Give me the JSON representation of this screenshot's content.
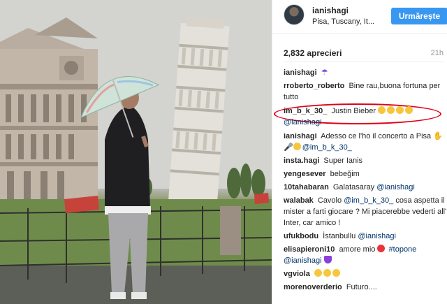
{
  "post": {
    "username": "ianishagi",
    "location": "Pisa, Tuscany, It...",
    "follow_label": "Urmărește",
    "likes": "2,832 aprecieri",
    "time": "21h"
  },
  "colors": {
    "follow_button": "#3897f0",
    "mention": "#003569",
    "highlight_ellipse": "#e0001b"
  },
  "comments": [
    {
      "user": "ianishagi",
      "text": "",
      "emoji": "umbrella-icon"
    },
    {
      "user": "rroberto_roberto",
      "text": "Bine rau,buona fortuna per tutto"
    },
    {
      "user": "im_b_k_30_",
      "text": "Justin Bieber",
      "emoji": "laughing-icon x4",
      "mention": "@ianishagi"
    },
    {
      "user": "ianishagi",
      "text": "Adesso ce l'ho il concerto a Pisa",
      "mention": "@im_b_k_30_"
    },
    {
      "user": "insta.hagi",
      "text": "Super Ianis"
    },
    {
      "user": "yengesever",
      "text": "bebeğim"
    },
    {
      "user": "10tahabaran",
      "text": "Galatasaray",
      "mention": "@ianishagi"
    },
    {
      "user": "walabak",
      "text": "Cavolo",
      "mention": "@im_b_k_30_",
      "text2": "cosa aspetta il mister a farti giocare ? Mi piacerebbe vederti all' Inter, car amico !"
    },
    {
      "user": "ufukbodu",
      "text": "İstanbullu",
      "mention": "@ianishagi"
    },
    {
      "user": "elisapieroni10",
      "text": "amore mio",
      "hashtag": "#topone",
      "mention": "@ianishagi"
    },
    {
      "user": "vgviola",
      "text": ""
    },
    {
      "user": "morenoverderio",
      "text": "Futuro...."
    }
  ]
}
